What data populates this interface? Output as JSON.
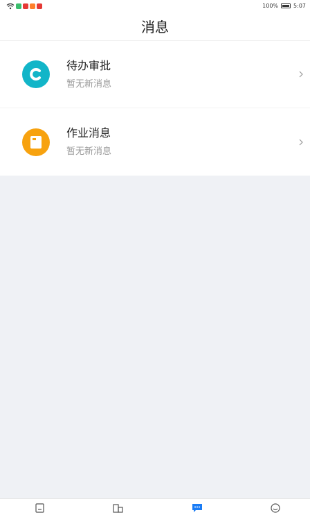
{
  "status_bar": {
    "battery": "100%",
    "time": "5:07",
    "app_icon_colors": [
      "#3bbd6d",
      "#e53935",
      "#ff7f2a",
      "#e53935"
    ]
  },
  "header": {
    "title": "消息"
  },
  "messages": [
    {
      "title": "待办审批",
      "subtitle": "暂无新消息",
      "icon": "approval-icon",
      "color": "#12b5c8"
    },
    {
      "title": "作业消息",
      "subtitle": "暂无新消息",
      "icon": "homework-icon",
      "color": "#f7a20f"
    }
  ],
  "tabs": [
    {
      "icon": "notebook-icon",
      "active": false
    },
    {
      "icon": "building-icon",
      "active": false
    },
    {
      "icon": "message-icon",
      "active": true
    },
    {
      "icon": "smile-icon",
      "active": false
    }
  ],
  "colors": {
    "accent": "#1a7cf5",
    "background": "#eff1f5"
  }
}
